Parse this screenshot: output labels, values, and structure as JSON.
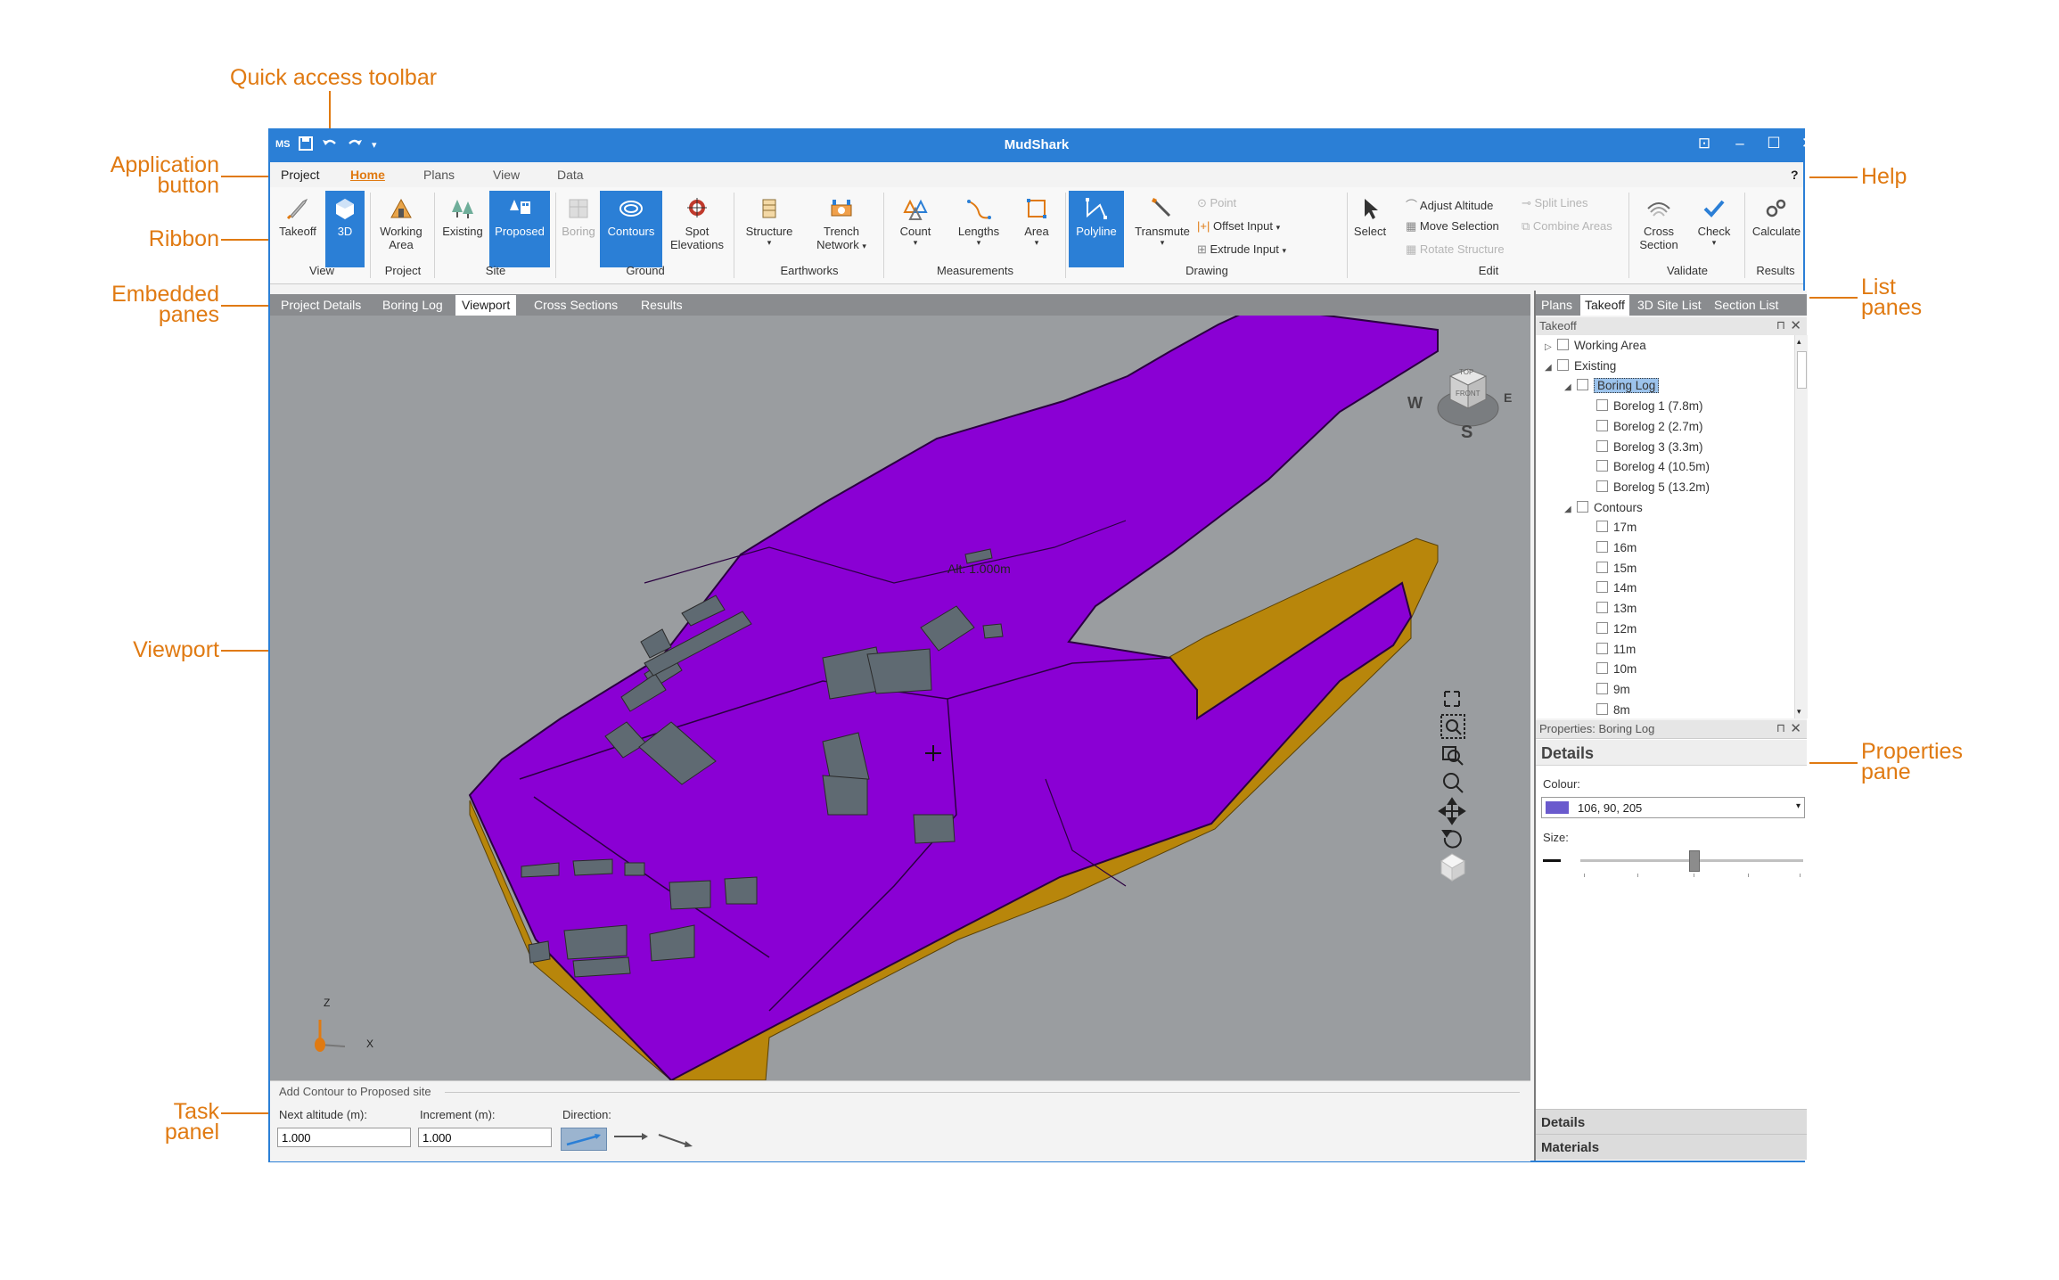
{
  "callouts": {
    "quick_access": "Quick access toolbar",
    "application_button": [
      "Application",
      "button"
    ],
    "ribbon": "Ribbon",
    "embedded_panes": [
      "Embedded",
      "panes"
    ],
    "viewport": "Viewport",
    "task_panel": [
      "Task",
      "panel"
    ],
    "help": "Help",
    "list_panes": [
      "List",
      "panes"
    ],
    "properties_pane": [
      "Properties",
      "pane"
    ]
  },
  "window": {
    "title": "MudShark",
    "qat_logo": "MS",
    "help_glyph": "?",
    "controls": [
      "⊡",
      "–",
      "☐",
      "✕"
    ]
  },
  "menu": {
    "project": "Project",
    "tabs": [
      "Home",
      "Plans",
      "View",
      "Data"
    ]
  },
  "ribbon": {
    "buttons": {
      "takeoff": "Takeoff",
      "three_d": "3D",
      "working_area": [
        "Working",
        "Area"
      ],
      "existing": "Existing",
      "proposed": "Proposed",
      "boring": "Boring",
      "contours": "Contours",
      "spot_elevations": [
        "Spot",
        "Elevations"
      ],
      "structure": "Structure",
      "trench_network": [
        "Trench",
        "Network"
      ],
      "count": "Count",
      "lengths": "Lengths",
      "area": "Area",
      "polyline": "Polyline",
      "transmute": "Transmute",
      "point": "Point",
      "offset_input": "Offset Input",
      "extrude_input": "Extrude Input",
      "select": "Select",
      "adjust_altitude": "Adjust Altitude",
      "move_selection": "Move Selection",
      "rotate_structure": "Rotate Structure",
      "split_lines": "Split Lines",
      "combine_areas": "Combine Areas",
      "cross_section": [
        "Cross",
        "Section"
      ],
      "check": "Check",
      "calculate": "Calculate"
    },
    "groups": [
      "View",
      "Project",
      "Site",
      "Ground",
      "Earthworks",
      "Measurements",
      "Drawing",
      "Edit",
      "Validate",
      "Results"
    ]
  },
  "embedded_tabs": [
    "Project Details",
    "Boring Log",
    "Viewport",
    "Cross Sections",
    "Results"
  ],
  "viewport": {
    "altitude_readout": "Alt: 1.000m",
    "compass": {
      "top": "TOP",
      "front": "FRONT",
      "west": "W",
      "east": "E",
      "south": "S"
    },
    "axes": {
      "z": "Z",
      "x": "X"
    },
    "surface_color": "#8a00d4",
    "side_color": "#b8860b"
  },
  "task_panel": {
    "title": "Add Contour to Proposed site",
    "next_altitude_label": "Next altitude (m):",
    "next_altitude_value": "1.000",
    "increment_label": "Increment (m):",
    "increment_value": "1.000",
    "direction_label": "Direction:"
  },
  "list_tabs": [
    "Plans",
    "Takeoff",
    "3D Site List",
    "Section List"
  ],
  "takeoff_pane": {
    "title": "Takeoff",
    "pin": "⊓",
    "close": "✕",
    "tree": [
      {
        "label": "Working Area",
        "level": 0,
        "arrow": "▷"
      },
      {
        "label": "Existing",
        "level": 0,
        "arrow": "◢"
      },
      {
        "label": "Boring Log",
        "level": 1,
        "arrow": "◢",
        "selected": true
      },
      {
        "label": "Borelog 1 (7.8m)",
        "level": 2
      },
      {
        "label": "Borelog 2 (2.7m)",
        "level": 2
      },
      {
        "label": "Borelog 3 (3.3m)",
        "level": 2
      },
      {
        "label": "Borelog 4 (10.5m)",
        "level": 2
      },
      {
        "label": "Borelog 5 (13.2m)",
        "level": 2
      },
      {
        "label": "Contours",
        "level": 1,
        "arrow": "◢"
      },
      {
        "label": "17m",
        "level": 2
      },
      {
        "label": "16m",
        "level": 2
      },
      {
        "label": "15m",
        "level": 2
      },
      {
        "label": "14m",
        "level": 2
      },
      {
        "label": "13m",
        "level": 2
      },
      {
        "label": "12m",
        "level": 2
      },
      {
        "label": "11m",
        "level": 2
      },
      {
        "label": "10m",
        "level": 2
      },
      {
        "label": "9m",
        "level": 2
      },
      {
        "label": "8m",
        "level": 2
      }
    ]
  },
  "properties_pane": {
    "title": "Properties: Boring Log",
    "section": "Details",
    "colour_label": "Colour:",
    "colour_value": "106, 90, 205",
    "colour_swatch": "#6a5acd",
    "size_label": "Size:",
    "bottom_tabs": [
      "Details",
      "Materials"
    ]
  }
}
